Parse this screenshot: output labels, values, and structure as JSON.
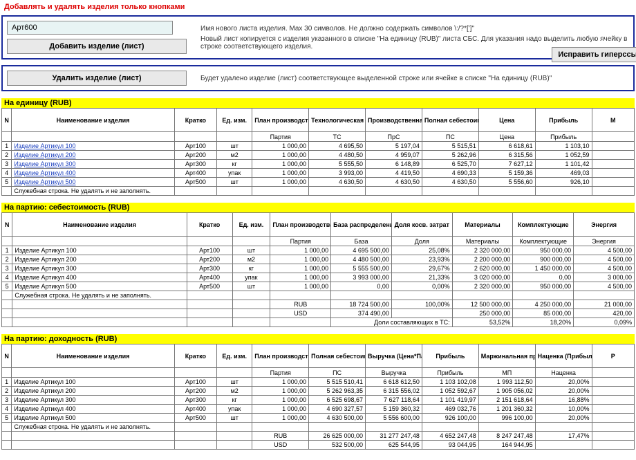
{
  "warning": "Добавлять и удалять изделия только кнопками",
  "form_add": {
    "input_value": "Арт600",
    "hint1": "Имя нового листа изделия. Max 30 символов. Не должно содержать символов \\:/?*[']\"",
    "btn_label": "Добавить изделие (лист)",
    "hint2": "Новый лист копируется с изделия указанного в списке \"На единицу (RUB)\" листа СБС. Для указания надо выделить любую ячейку в строке соответствующего изделия."
  },
  "form_del": {
    "btn_label": "Удалить изделие (лист)",
    "hint": "Будет удалено изделие (лист) соответствующее выделенной строке или ячейке в списке \"На единицу (RUB)\""
  },
  "btn_fix": "Исправить гиперссыл",
  "sec1": {
    "title": "На единицу (RUB)",
    "headers": {
      "n": "N",
      "name": "Наименование изделия",
      "short": "Кратко",
      "unit": "Ед. изм.",
      "plan": "План производства (количество)",
      "tc": "Технологическая себестоимость",
      "prc": "Производственная себестоимость",
      "pc": "Полная себестоимость (RUB)",
      "price": "Цена",
      "profit": "Прибыль",
      "extra": "М"
    },
    "sub": {
      "plan": "Партия",
      "tc": "ТС",
      "prc": "ПрС",
      "pc": "ПС",
      "price": "Цена",
      "profit": "Прибыль"
    },
    "rows": [
      {
        "n": "1",
        "name": "Изделие Артикул 100",
        "short": "Арт100",
        "unit": "шт",
        "plan": "1 000,00",
        "tc": "4 695,50",
        "prc": "5 197,04",
        "pc": "5 515,51",
        "price": "6 618,61",
        "profit": "1 103,10"
      },
      {
        "n": "2",
        "name": "Изделие Артикул 200",
        "short": "Арт200",
        "unit": "м2",
        "plan": "1 000,00",
        "tc": "4 480,50",
        "prc": "4 959,07",
        "pc": "5 262,96",
        "price": "6 315,56",
        "profit": "1 052,59"
      },
      {
        "n": "3",
        "name": "Изделие Артикул 300",
        "short": "Арт300",
        "unit": "кг",
        "plan": "1 000,00",
        "tc": "5 555,50",
        "prc": "6 148,89",
        "pc": "6 525,70",
        "price": "7 627,12",
        "profit": "1 101,42"
      },
      {
        "n": "4",
        "name": "Изделие Артикул 400",
        "short": "Арт400",
        "unit": "упак",
        "plan": "1 000,00",
        "tc": "3 993,00",
        "prc": "4 419,50",
        "pc": "4 690,33",
        "price": "5 159,36",
        "profit": "469,03"
      },
      {
        "n": "5",
        "name": "Изделие Артикул 500",
        "short": "Арт500",
        "unit": "шт",
        "plan": "1 000,00",
        "tc": "4 630,50",
        "prc": "4 630,50",
        "pc": "4 630,50",
        "price": "5 556,60",
        "profit": "926,10"
      }
    ],
    "service": "Служебная строка. Не удалять и не заполнять."
  },
  "sec2": {
    "title": "На партию: себестоимость (RUB)",
    "headers": {
      "n": "N",
      "name": "Наименование изделия",
      "short": "Кратко",
      "unit": "Ед. изм.",
      "plan": "План производства (количество)",
      "base": "База распределения",
      "share": "Доля косв. затрат",
      "mat": "Материалы",
      "comp": "Комплектующие",
      "energy": "Энергия"
    },
    "sub": {
      "plan": "Партия",
      "base": "База",
      "share": "Доля",
      "mat": "Материалы",
      "comp": "Комплектующие",
      "energy": "Энергия"
    },
    "rows": [
      {
        "n": "1",
        "name": "Изделие Артикул 100",
        "short": "Арт100",
        "unit": "шт",
        "plan": "1 000,00",
        "base": "4 695 500,00",
        "share": "25,08%",
        "mat": "2 320 000,00",
        "comp": "950 000,00",
        "energy": "4 500,00"
      },
      {
        "n": "2",
        "name": "Изделие Артикул 200",
        "short": "Арт200",
        "unit": "м2",
        "plan": "1 000,00",
        "base": "4 480 500,00",
        "share": "23,93%",
        "mat": "2 200 000,00",
        "comp": "900 000,00",
        "energy": "4 500,00"
      },
      {
        "n": "3",
        "name": "Изделие Артикул 300",
        "short": "Арт300",
        "unit": "кг",
        "plan": "1 000,00",
        "base": "5 555 500,00",
        "share": "29,67%",
        "mat": "2 620 000,00",
        "comp": "1 450 000,00",
        "energy": "4 500,00"
      },
      {
        "n": "4",
        "name": "Изделие Артикул 400",
        "short": "Арт400",
        "unit": "упак",
        "plan": "1 000,00",
        "base": "3 993 000,00",
        "share": "21,33%",
        "mat": "3 020 000,00",
        "comp": "0,00",
        "energy": "3 000,00"
      },
      {
        "n": "5",
        "name": "Изделие Артикул 500",
        "short": "Арт500",
        "unit": "шт",
        "plan": "1 000,00",
        "base": "0,00",
        "share": "0,00%",
        "mat": "2 320 000,00",
        "comp": "950 000,00",
        "energy": "4 500,00"
      }
    ],
    "service": "Служебная строка. Не удалять и не заполнять.",
    "footer_rub": {
      "lbl": "RUB",
      "base": "18 724 500,00",
      "share": "100,00%",
      "mat": "12 500 000,00",
      "comp": "4 250 000,00",
      "energy": "21 000,00"
    },
    "footer_usd": {
      "lbl": "USD",
      "base": "374 490,00",
      "share": "",
      "mat": "250 000,00",
      "comp": "85 000,00",
      "energy": "420,00"
    },
    "footer_share": {
      "lbl": "Доли составляющих в ТС:",
      "mat": "53,52%",
      "comp": "18,20%",
      "energy": "0,09%"
    }
  },
  "sec3": {
    "title": "На партию: доходность (RUB)",
    "headers": {
      "n": "N",
      "name": "Наименование изделия",
      "short": "Кратко",
      "unit": "Ед. изм.",
      "plan": "План производства (количество)",
      "pc": "Полная себестоимость",
      "rev": "Выручка (Цена*Партия)",
      "profit": "Прибыль",
      "mp": "Маржинальная прибыль",
      "markup": "Наценка (Прибыль / ПС)",
      "extra": "Р"
    },
    "sub": {
      "plan": "Партия",
      "pc": "ПС",
      "rev": "Выручка",
      "profit": "Прибыль",
      "mp": "МП",
      "markup": "Наценка"
    },
    "rows": [
      {
        "n": "1",
        "name": "Изделие Артикул 100",
        "short": "Арт100",
        "unit": "шт",
        "plan": "1 000,00",
        "pc": "5 515 510,41",
        "rev": "6 618 612,50",
        "profit": "1 103 102,08",
        "mp": "1 993 112,50",
        "markup": "20,00%"
      },
      {
        "n": "2",
        "name": "Изделие Артикул 200",
        "short": "Арт200",
        "unit": "м2",
        "plan": "1 000,00",
        "pc": "5 262 963,35",
        "rev": "6 315 556,02",
        "profit": "1 052 592,67",
        "mp": "1 905 056,02",
        "markup": "20,00%"
      },
      {
        "n": "3",
        "name": "Изделие Артикул 300",
        "short": "Арт300",
        "unit": "кг",
        "plan": "1 000,00",
        "pc": "6 525 698,67",
        "rev": "7 627 118,64",
        "profit": "1 101 419,97",
        "mp": "2 151 618,64",
        "markup": "16,88%"
      },
      {
        "n": "4",
        "name": "Изделие Артикул 400",
        "short": "Арт400",
        "unit": "упак",
        "plan": "1 000,00",
        "pc": "4 690 327,57",
        "rev": "5 159 360,32",
        "profit": "469 032,76",
        "mp": "1 201 360,32",
        "markup": "10,00%"
      },
      {
        "n": "5",
        "name": "Изделие Артикул 500",
        "short": "Арт500",
        "unit": "шт",
        "plan": "1 000,00",
        "pc": "4 630 500,00",
        "rev": "5 556 600,00",
        "profit": "926 100,00",
        "mp": "996 100,00",
        "markup": "20,00%"
      }
    ],
    "service": "Служебная строка. Не удалять и не заполнять.",
    "footer_rub": {
      "lbl": "RUB",
      "pc": "26 625 000,00",
      "rev": "31 277 247,48",
      "profit": "4 652 247,48",
      "mp": "8 247 247,48",
      "markup": "17,47%"
    },
    "footer_usd": {
      "lbl": "USD",
      "pc": "532 500,00",
      "rev": "625 544,95",
      "profit": "93 044,95",
      "mp": "164 944,95",
      "markup": ""
    }
  }
}
